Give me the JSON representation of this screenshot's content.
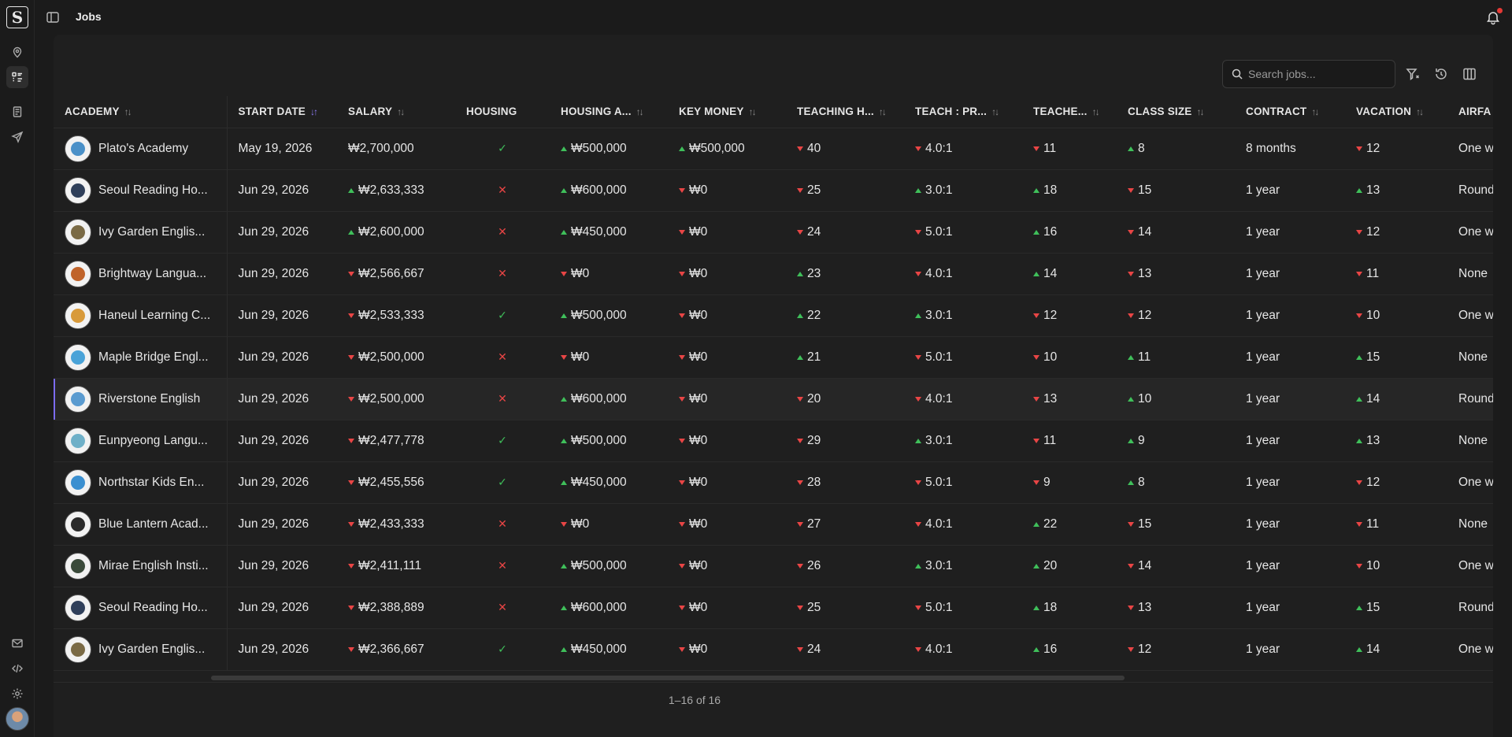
{
  "app": {
    "logo_letter": "S",
    "page_title": "Jobs"
  },
  "toolbar": {
    "search_placeholder": "Search jobs..."
  },
  "table": {
    "columns": [
      {
        "label": "ACADEMY",
        "sort": "none"
      },
      {
        "label": "START DATE",
        "sort": "asc"
      },
      {
        "label": "SALARY",
        "sort": "none"
      },
      {
        "label": "HOUSING",
        "sort": "off"
      },
      {
        "label": "HOUSING A...",
        "sort": "none"
      },
      {
        "label": "KEY MONEY",
        "sort": "none"
      },
      {
        "label": "TEACHING H...",
        "sort": "none"
      },
      {
        "label": "TEACH : PR...",
        "sort": "none"
      },
      {
        "label": "TEACHE...",
        "sort": "none"
      },
      {
        "label": "CLASS SIZE",
        "sort": "none"
      },
      {
        "label": "CONTRACT",
        "sort": "none"
      },
      {
        "label": "VACATION",
        "sort": "none"
      },
      {
        "label": "AIRFA",
        "sort": "off"
      }
    ],
    "rows": [
      {
        "academy": "Plato's Academy",
        "logo_color": "#4a90c8",
        "start": "May 19, 2026",
        "salary": "₩2,700,000",
        "salary_dir": "",
        "housing": true,
        "housing_allow": "₩500,000",
        "ha_dir": "up",
        "key_money": "₩500,000",
        "km_dir": "up",
        "teaching_hours": "40",
        "th_dir": "down",
        "ratio": "4.0:1",
        "ratio_dir": "down",
        "teachers": "11",
        "t_dir": "down",
        "class_size": "8",
        "cs_dir": "up",
        "contract": "8 months",
        "vacation": "12",
        "v_dir": "down",
        "airfare": "One w"
      },
      {
        "academy": "Seoul Reading Ho...",
        "logo_color": "#2f3f5a",
        "start": "Jun 29, 2026",
        "salary": "₩2,633,333",
        "salary_dir": "up",
        "housing": false,
        "housing_allow": "₩600,000",
        "ha_dir": "up",
        "key_money": "₩0",
        "km_dir": "down",
        "teaching_hours": "25",
        "th_dir": "down",
        "ratio": "3.0:1",
        "ratio_dir": "up",
        "teachers": "18",
        "t_dir": "up",
        "class_size": "15",
        "cs_dir": "down",
        "contract": "1 year",
        "vacation": "13",
        "v_dir": "up",
        "airfare": "Round"
      },
      {
        "academy": "Ivy Garden Englis...",
        "logo_color": "#7a6a45",
        "start": "Jun 29, 2026",
        "salary": "₩2,600,000",
        "salary_dir": "up",
        "housing": false,
        "housing_allow": "₩450,000",
        "ha_dir": "up",
        "key_money": "₩0",
        "km_dir": "down",
        "teaching_hours": "24",
        "th_dir": "down",
        "ratio": "5.0:1",
        "ratio_dir": "down",
        "teachers": "16",
        "t_dir": "up",
        "class_size": "14",
        "cs_dir": "down",
        "contract": "1 year",
        "vacation": "12",
        "v_dir": "down",
        "airfare": "One w"
      },
      {
        "academy": "Brightway Langua...",
        "logo_color": "#c0632a",
        "start": "Jun 29, 2026",
        "salary": "₩2,566,667",
        "salary_dir": "down",
        "housing": false,
        "housing_allow": "₩0",
        "ha_dir": "down",
        "key_money": "₩0",
        "km_dir": "down",
        "teaching_hours": "23",
        "th_dir": "up",
        "ratio": "4.0:1",
        "ratio_dir": "down",
        "teachers": "14",
        "t_dir": "up",
        "class_size": "13",
        "cs_dir": "down",
        "contract": "1 year",
        "vacation": "11",
        "v_dir": "down",
        "airfare": "None"
      },
      {
        "academy": "Haneul Learning C...",
        "logo_color": "#d89a3a",
        "start": "Jun 29, 2026",
        "salary": "₩2,533,333",
        "salary_dir": "down",
        "housing": true,
        "housing_allow": "₩500,000",
        "ha_dir": "up",
        "key_money": "₩0",
        "km_dir": "down",
        "teaching_hours": "22",
        "th_dir": "up",
        "ratio": "3.0:1",
        "ratio_dir": "up",
        "teachers": "12",
        "t_dir": "down",
        "class_size": "12",
        "cs_dir": "down",
        "contract": "1 year",
        "vacation": "10",
        "v_dir": "down",
        "airfare": "One w"
      },
      {
        "academy": "Maple Bridge Engl...",
        "logo_color": "#4aa3d8",
        "start": "Jun 29, 2026",
        "salary": "₩2,500,000",
        "salary_dir": "down",
        "housing": false,
        "housing_allow": "₩0",
        "ha_dir": "down",
        "key_money": "₩0",
        "km_dir": "down",
        "teaching_hours": "21",
        "th_dir": "up",
        "ratio": "5.0:1",
        "ratio_dir": "down",
        "teachers": "10",
        "t_dir": "down",
        "class_size": "11",
        "cs_dir": "up",
        "contract": "1 year",
        "vacation": "15",
        "v_dir": "up",
        "airfare": "None"
      },
      {
        "academy": "Riverstone English",
        "logo_color": "#5a9bd0",
        "start": "Jun 29, 2026",
        "salary": "₩2,500,000",
        "salary_dir": "down",
        "housing": false,
        "housing_allow": "₩600,000",
        "ha_dir": "up",
        "key_money": "₩0",
        "km_dir": "down",
        "teaching_hours": "20",
        "th_dir": "down",
        "ratio": "4.0:1",
        "ratio_dir": "down",
        "teachers": "13",
        "t_dir": "down",
        "class_size": "10",
        "cs_dir": "up",
        "contract": "1 year",
        "vacation": "14",
        "v_dir": "up",
        "airfare": "Round",
        "highlight": true
      },
      {
        "academy": "Eunpyeong Langu...",
        "logo_color": "#6fb0c8",
        "start": "Jun 29, 2026",
        "salary": "₩2,477,778",
        "salary_dir": "down",
        "housing": true,
        "housing_allow": "₩500,000",
        "ha_dir": "up",
        "key_money": "₩0",
        "km_dir": "down",
        "teaching_hours": "29",
        "th_dir": "down",
        "ratio": "3.0:1",
        "ratio_dir": "up",
        "teachers": "11",
        "t_dir": "down",
        "class_size": "9",
        "cs_dir": "up",
        "contract": "1 year",
        "vacation": "13",
        "v_dir": "up",
        "airfare": "None"
      },
      {
        "academy": "Northstar Kids En...",
        "logo_color": "#3a8fd0",
        "start": "Jun 29, 2026",
        "salary": "₩2,455,556",
        "salary_dir": "down",
        "housing": true,
        "housing_allow": "₩450,000",
        "ha_dir": "up",
        "key_money": "₩0",
        "km_dir": "down",
        "teaching_hours": "28",
        "th_dir": "down",
        "ratio": "5.0:1",
        "ratio_dir": "down",
        "teachers": "9",
        "t_dir": "down",
        "class_size": "8",
        "cs_dir": "up",
        "contract": "1 year",
        "vacation": "12",
        "v_dir": "down",
        "airfare": "One w"
      },
      {
        "academy": "Blue Lantern Acad...",
        "logo_color": "#2a2a2a",
        "start": "Jun 29, 2026",
        "salary": "₩2,433,333",
        "salary_dir": "down",
        "housing": false,
        "housing_allow": "₩0",
        "ha_dir": "down",
        "key_money": "₩0",
        "km_dir": "down",
        "teaching_hours": "27",
        "th_dir": "down",
        "ratio": "4.0:1",
        "ratio_dir": "down",
        "teachers": "22",
        "t_dir": "up",
        "class_size": "15",
        "cs_dir": "down",
        "contract": "1 year",
        "vacation": "11",
        "v_dir": "down",
        "airfare": "None"
      },
      {
        "academy": "Mirae English Insti...",
        "logo_color": "#3a4a3a",
        "start": "Jun 29, 2026",
        "salary": "₩2,411,111",
        "salary_dir": "down",
        "housing": false,
        "housing_allow": "₩500,000",
        "ha_dir": "up",
        "key_money": "₩0",
        "km_dir": "down",
        "teaching_hours": "26",
        "th_dir": "down",
        "ratio": "3.0:1",
        "ratio_dir": "up",
        "teachers": "20",
        "t_dir": "up",
        "class_size": "14",
        "cs_dir": "down",
        "contract": "1 year",
        "vacation": "10",
        "v_dir": "down",
        "airfare": "One w"
      },
      {
        "academy": "Seoul Reading Ho...",
        "logo_color": "#2f3f5a",
        "start": "Jun 29, 2026",
        "salary": "₩2,388,889",
        "salary_dir": "down",
        "housing": false,
        "housing_allow": "₩600,000",
        "ha_dir": "up",
        "key_money": "₩0",
        "km_dir": "down",
        "teaching_hours": "25",
        "th_dir": "down",
        "ratio": "5.0:1",
        "ratio_dir": "down",
        "teachers": "18",
        "t_dir": "up",
        "class_size": "13",
        "cs_dir": "down",
        "contract": "1 year",
        "vacation": "15",
        "v_dir": "up",
        "airfare": "Round"
      },
      {
        "academy": "Ivy Garden Englis...",
        "logo_color": "#7a6a45",
        "start": "Jun 29, 2026",
        "salary": "₩2,366,667",
        "salary_dir": "down",
        "housing": true,
        "housing_allow": "₩450,000",
        "ha_dir": "up",
        "key_money": "₩0",
        "km_dir": "down",
        "teaching_hours": "24",
        "th_dir": "down",
        "ratio": "4.0:1",
        "ratio_dir": "down",
        "teachers": "16",
        "t_dir": "up",
        "class_size": "12",
        "cs_dir": "down",
        "contract": "1 year",
        "vacation": "14",
        "v_dir": "up",
        "airfare": "One w"
      }
    ]
  },
  "pagination": {
    "label": "1–16 of 16"
  },
  "colors": {
    "accent": "#8c7cf5",
    "up": "#3fbf5a",
    "down": "#e84545",
    "notification": "#e53935"
  },
  "icons": {
    "rail": [
      "map-pin-icon",
      "list-icon",
      "document-icon",
      "send-icon",
      "mail-icon",
      "code-icon",
      "settings-icon"
    ],
    "toolbar": [
      "filter-icon",
      "reset-icon",
      "columns-icon"
    ]
  }
}
